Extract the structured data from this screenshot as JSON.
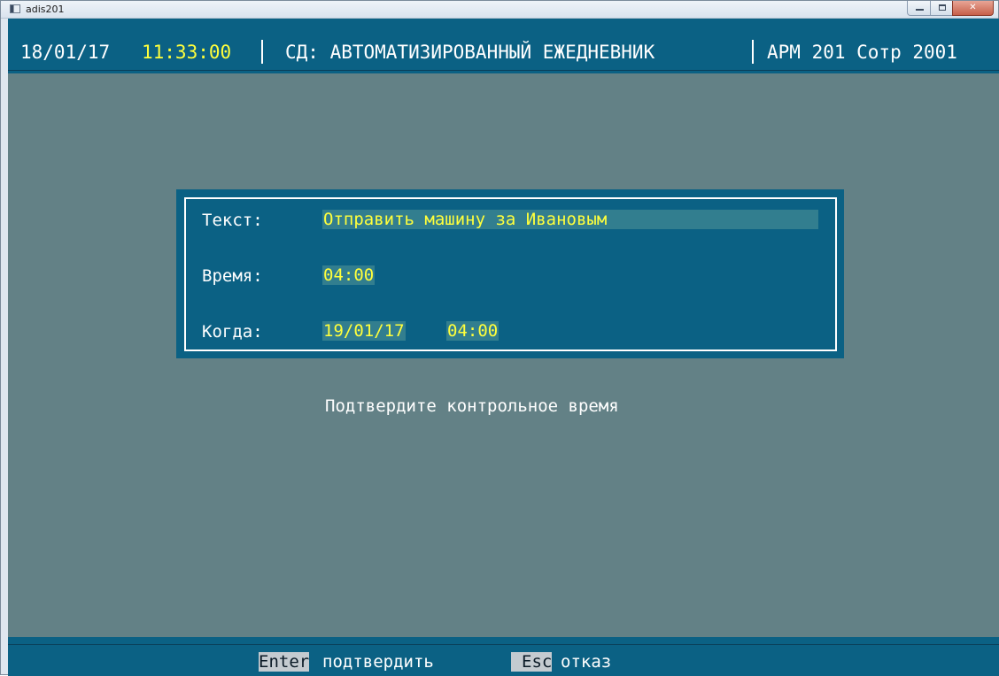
{
  "window": {
    "title": "adis201"
  },
  "header": {
    "date": "18/01/17",
    "time": "11:33:00",
    "app_title": "СД: АВТОМАТИЗИРОВАННЫЙ ЕЖЕДНЕВНИК",
    "workstation": "АРМ 201 Сотр 2001"
  },
  "dialog": {
    "text_label": "Текст:",
    "text_value": "Отправить машину за Ивановым",
    "time_label": "Время:",
    "time_value": "04:00",
    "when_label": "Когда:",
    "when_date": "19/01/17",
    "when_time": "04:00"
  },
  "message": "Подтвердите контрольное время",
  "footer": {
    "enter_key": "Enter",
    "enter_label": "подтвердить",
    "esc_key": "Esc",
    "esc_label": "отказ"
  },
  "colors": {
    "background": "#638186",
    "panel": "#0b6184",
    "field_text": "#ffff3c",
    "field_bg": "#327e8f",
    "key_bg": "#c4cbd0"
  },
  "icons": [
    "app-icon",
    "minimize-icon",
    "maximize-icon",
    "close-icon"
  ]
}
